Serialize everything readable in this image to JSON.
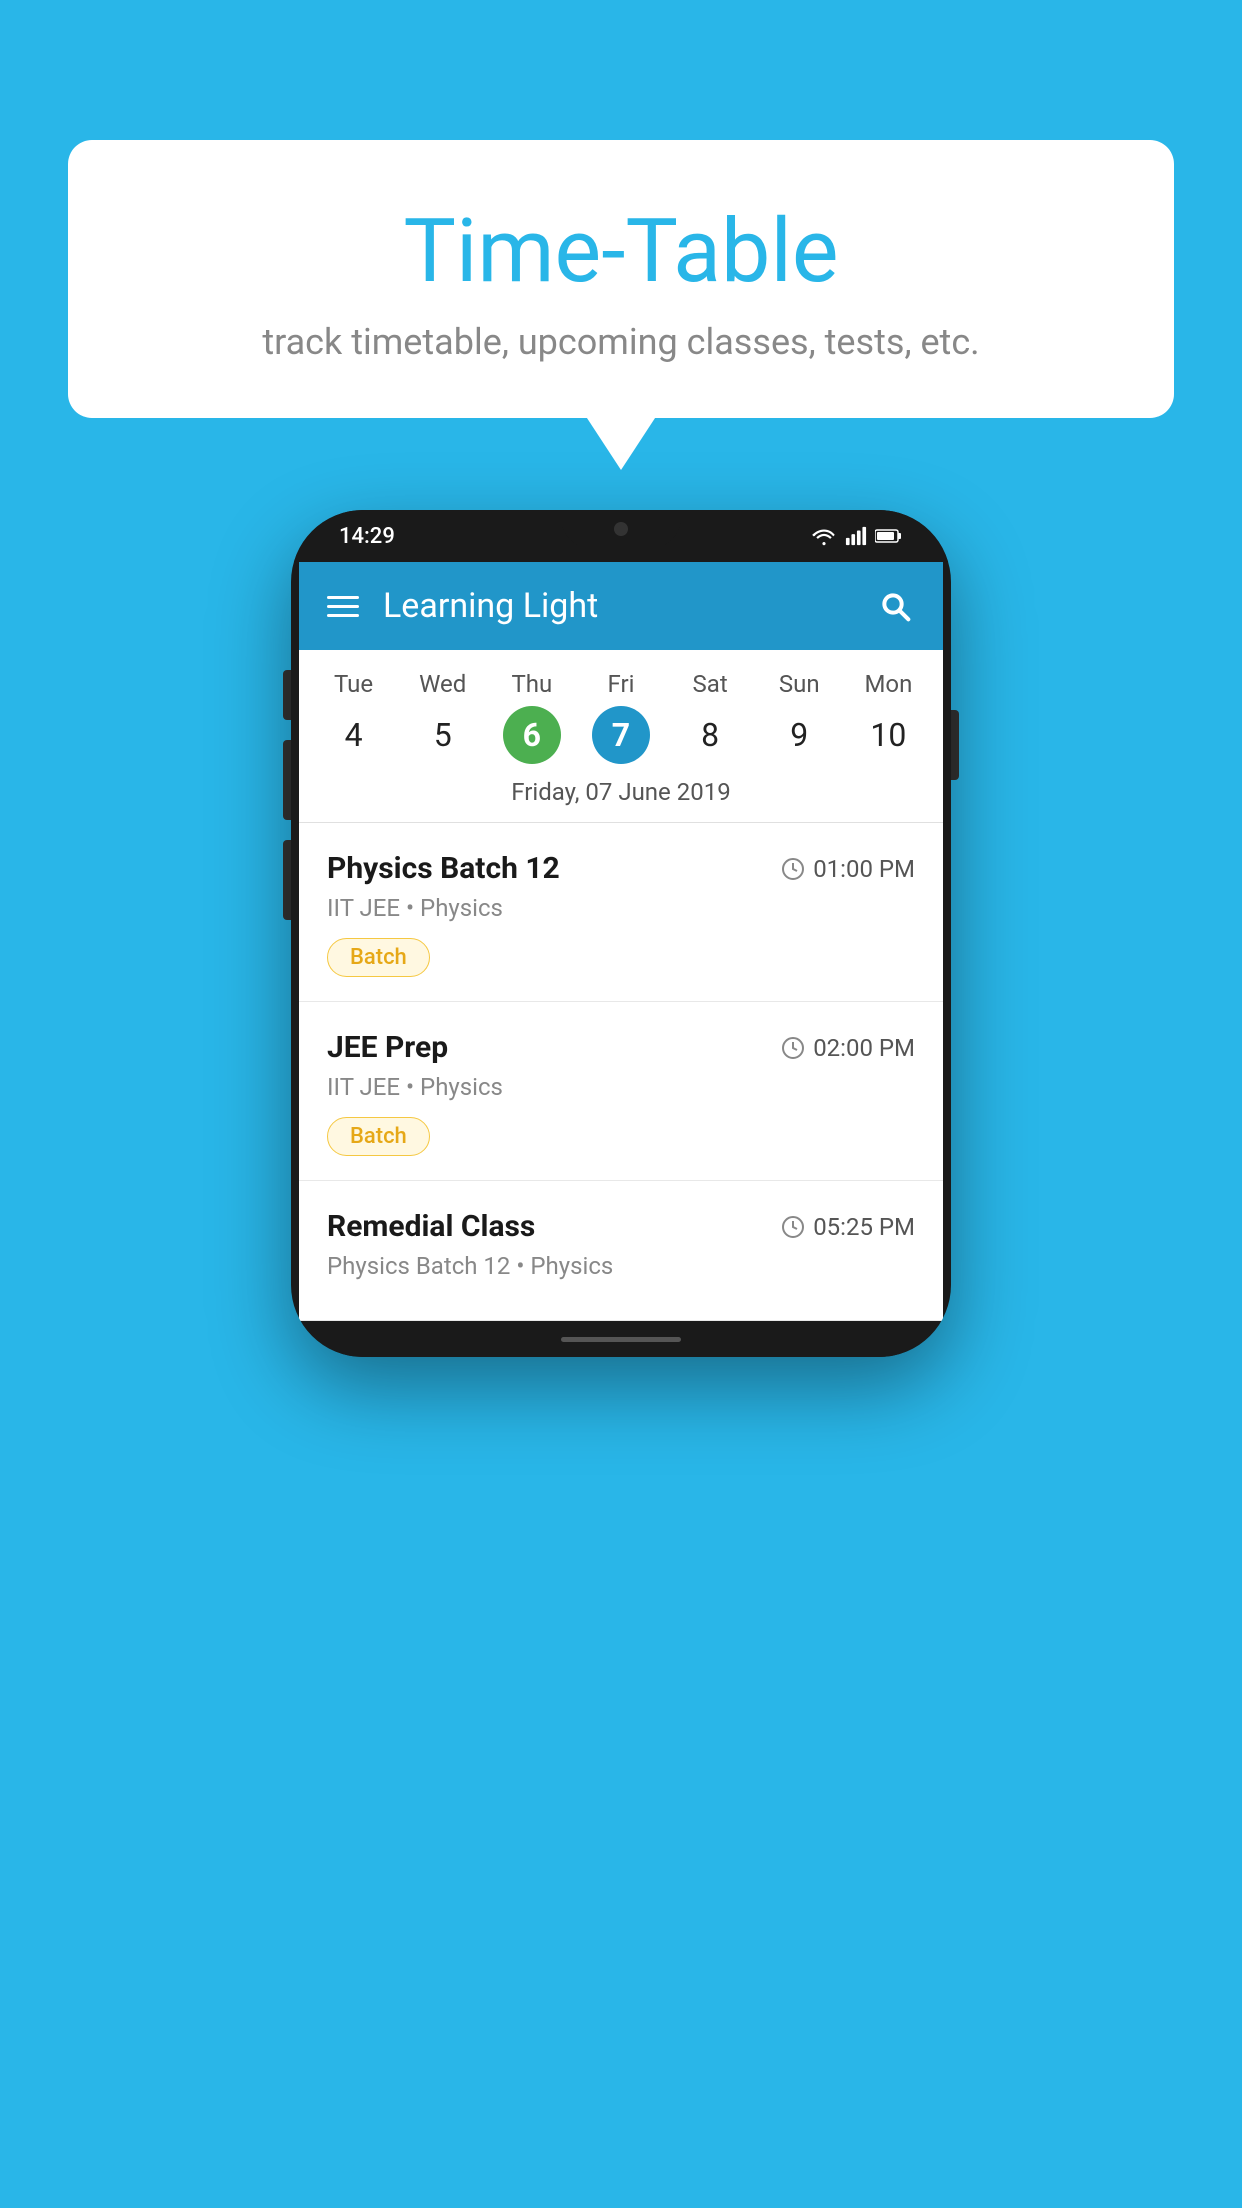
{
  "background_color": "#29B6E8",
  "speech_bubble": {
    "title": "Time-Table",
    "subtitle": "track timetable, upcoming classes, tests, etc."
  },
  "phone": {
    "status_bar": {
      "time": "14:29",
      "icons": [
        "wifi",
        "signal",
        "battery"
      ]
    },
    "app_bar": {
      "title": "Learning Light",
      "menu_icon": "hamburger",
      "search_icon": "search"
    },
    "calendar": {
      "days": [
        {
          "name": "Tue",
          "number": "4",
          "state": "normal"
        },
        {
          "name": "Wed",
          "number": "5",
          "state": "normal"
        },
        {
          "name": "Thu",
          "number": "6",
          "state": "today"
        },
        {
          "name": "Fri",
          "number": "7",
          "state": "selected"
        },
        {
          "name": "Sat",
          "number": "8",
          "state": "normal"
        },
        {
          "name": "Sun",
          "number": "9",
          "state": "normal"
        },
        {
          "name": "Mon",
          "number": "10",
          "state": "normal"
        }
      ],
      "selected_date_label": "Friday, 07 June 2019"
    },
    "classes": [
      {
        "name": "Physics Batch 12",
        "time": "01:00 PM",
        "subtitle": "IIT JEE • Physics",
        "badge": "Batch"
      },
      {
        "name": "JEE Prep",
        "time": "02:00 PM",
        "subtitle": "IIT JEE • Physics",
        "badge": "Batch"
      },
      {
        "name": "Remedial Class",
        "time": "05:25 PM",
        "subtitle": "Physics Batch 12 • Physics",
        "badge": null
      }
    ]
  }
}
